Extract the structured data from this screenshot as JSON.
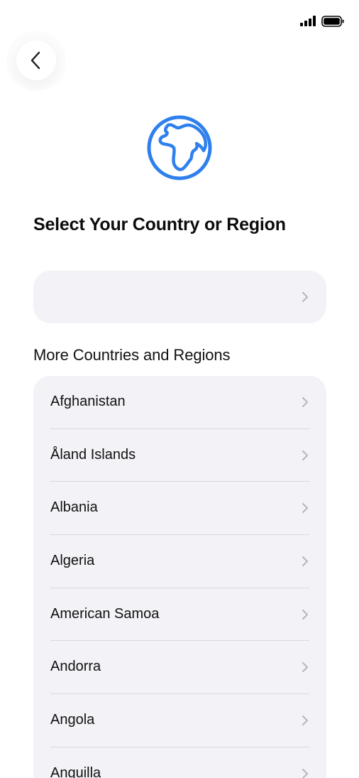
{
  "status_bar": {
    "signal_icon": "cellular-signal-icon",
    "battery_icon": "battery-full-icon"
  },
  "back_button": {
    "icon": "chevron-left-icon"
  },
  "header": {
    "icon": "globe-icon",
    "accent_color": "#2F80ED",
    "title": "Select Your Country or Region"
  },
  "suggested": {
    "label": "",
    "chevron_icon": "chevron-right-icon"
  },
  "more": {
    "header": "More Countries and Regions",
    "items": [
      {
        "label": "Afghanistan"
      },
      {
        "label": "Åland Islands"
      },
      {
        "label": "Albania"
      },
      {
        "label": "Algeria"
      },
      {
        "label": "American Samoa"
      },
      {
        "label": "Andorra"
      },
      {
        "label": "Angola"
      },
      {
        "label": "Anguilla"
      }
    ]
  }
}
